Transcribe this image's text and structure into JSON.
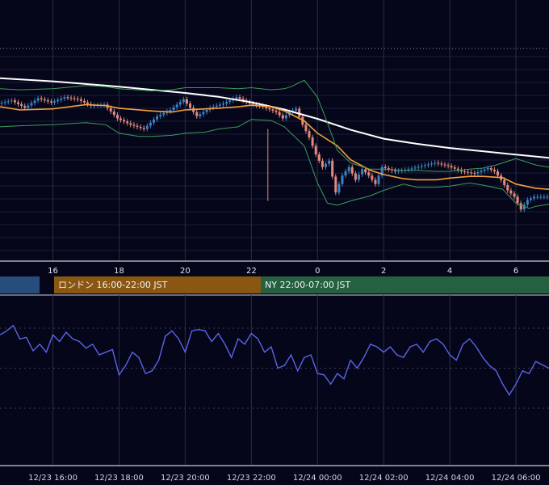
{
  "chart_data": [
    {
      "type": "candlestick",
      "title": "",
      "x_ticks": [
        "16",
        "18",
        "20",
        "22",
        "0",
        "2",
        "4",
        "6"
      ],
      "x_tick_hours": [
        16,
        18,
        20,
        22,
        24,
        26,
        28,
        30
      ],
      "x_range_hours": [
        14.4,
        31.0
      ],
      "y_range": [
        0,
        100
      ],
      "grid": true,
      "overlays": [
        {
          "name": "",
          "kind": "moving-average-long",
          "color": "#ffffff",
          "hours": [
            14.4,
            16,
            18,
            20,
            21,
            22,
            23,
            24,
            25,
            26,
            27,
            28,
            29,
            30,
            31
          ],
          "values": [
            86.0,
            84.5,
            82.0,
            79.0,
            77.2,
            74.6,
            71.2,
            66.8,
            61.6,
            57.4,
            55.0,
            53.0,
            51.5,
            49.9,
            48.4
          ]
        },
        {
          "name": "",
          "kind": "moving-average-short",
          "color": "#f5a03a",
          "hours": [
            14.4,
            15,
            16,
            17,
            17.6,
            18,
            19,
            19.6,
            20,
            21,
            21.6,
            22,
            22.6,
            23,
            23.6,
            24,
            24.6,
            25,
            25.6,
            26,
            26.6,
            27,
            27.6,
            28,
            28.6,
            29,
            29.6,
            30,
            30.6,
            31
          ],
          "values": [
            72.5,
            71.0,
            71.5,
            73.5,
            73.0,
            71.8,
            70.5,
            70.0,
            71.0,
            71.8,
            72.5,
            73.2,
            72.5,
            70.5,
            65.8,
            60.0,
            54.0,
            47.5,
            42.5,
            40.5,
            38.5,
            38.0,
            38.0,
            38.8,
            39.6,
            39.6,
            39.0,
            36.0,
            34.0,
            33.5
          ]
        },
        {
          "name": "",
          "kind": "bollinger-upper",
          "color": "#3c9c5a",
          "hours": [
            14.4,
            15,
            16,
            17,
            17.6,
            18,
            19,
            19.6,
            20,
            21,
            21.6,
            22,
            22.6,
            23,
            23.2,
            23.6,
            24,
            24.3,
            24.6,
            25,
            25.6,
            26,
            26.6,
            27,
            27.6,
            28,
            28.6,
            29,
            29.4,
            30,
            30.6,
            31
          ],
          "values": [
            81.0,
            80.5,
            81.0,
            82.5,
            82.0,
            81.0,
            80.0,
            80.5,
            81.5,
            81.5,
            81.0,
            81.5,
            80.5,
            81.0,
            82.0,
            85.0,
            77.0,
            65.0,
            52.0,
            46.0,
            43.0,
            43.0,
            42.5,
            42.5,
            42.0,
            42.0,
            43.0,
            43.5,
            45.0,
            48.0,
            45.0,
            44.0
          ]
        },
        {
          "name": "",
          "kind": "bollinger-lower",
          "color": "#3c9c5a",
          "hours": [
            14.4,
            15,
            16,
            17,
            17.6,
            18,
            18.6,
            19,
            19.6,
            20,
            20.6,
            21,
            21.6,
            22,
            22.6,
            23,
            23.6,
            24,
            24.3,
            24.6,
            25,
            25.6,
            26,
            26.6,
            27,
            27.6,
            28,
            28.6,
            29,
            29.6,
            30,
            30.4,
            30.6,
            31
          ],
          "values": [
            63.0,
            63.5,
            64.0,
            65.0,
            64.0,
            60.0,
            58.5,
            58.5,
            59.0,
            60.0,
            60.5,
            62.0,
            63.0,
            66.5,
            66.0,
            63.0,
            54.0,
            36.5,
            27.0,
            26.0,
            28.0,
            30.5,
            33.0,
            36.0,
            34.5,
            34.5,
            35.0,
            36.5,
            35.5,
            33.5,
            27.0,
            24.5,
            25.5,
            26.5
          ]
        },
        {
          "name": "",
          "kind": "price-trace",
          "color": "#3b82c4",
          "hours": [
            14.4,
            14.8,
            15.2,
            15.6,
            16.0,
            16.4,
            16.8,
            17.2,
            17.6,
            18.0,
            18.4,
            18.8,
            19.2,
            19.6,
            20.0,
            20.4,
            20.8,
            21.2,
            21.6,
            22.0,
            22.4,
            22.8,
            23.0,
            23.2,
            23.4,
            23.6,
            23.8,
            24.0,
            24.2,
            24.4,
            24.6,
            24.8,
            25.0,
            25.2,
            25.4,
            25.6,
            25.8,
            26.0,
            26.4,
            26.8,
            27.2,
            27.6,
            28.0,
            28.4,
            28.8,
            29.2,
            29.4,
            29.6,
            29.8,
            30.0,
            30.2,
            30.4,
            30.6,
            31.0
          ],
          "values": [
            74.0,
            75.5,
            72.0,
            76.5,
            74.5,
            77.0,
            76.0,
            73.0,
            73.5,
            67.0,
            64.0,
            62.0,
            68.0,
            71.0,
            76.0,
            68.0,
            72.0,
            74.0,
            77.0,
            74.0,
            72.5,
            70.0,
            67.0,
            70.0,
            71.5,
            64.0,
            58.0,
            50.0,
            44.0,
            47.0,
            32.0,
            40.0,
            44.0,
            38.0,
            43.0,
            40.0,
            36.0,
            44.0,
            42.0,
            43.0,
            44.5,
            46.0,
            44.5,
            42.0,
            41.0,
            43.5,
            42.0,
            38.0,
            33.0,
            30.0,
            24.0,
            28.5,
            30.0,
            30.0
          ]
        }
      ],
      "annotations": {
        "dotted_level": 100,
        "spike_low_hour": 22.5,
        "spike_low_value": 28
      }
    },
    {
      "type": "line",
      "title": "",
      "x_ticks": [
        "12/23 16:00",
        "12/23 18:00",
        "12/23 20:00",
        "12/23 22:00",
        "12/24 00:00",
        "12/24 02:00",
        "12/24 04:00",
        "12/24 06:00"
      ],
      "x_tick_hours": [
        16,
        18,
        20,
        22,
        24,
        26,
        28,
        30
      ],
      "x_range_hours": [
        14.4,
        31.0
      ],
      "y_range": [
        0,
        100
      ],
      "grid": true,
      "series": [
        {
          "name": "",
          "color": "#5b64e6",
          "hours": [
            14.4,
            14.6,
            14.8,
            15.0,
            15.2,
            15.4,
            15.6,
            15.8,
            16.0,
            16.2,
            16.4,
            16.6,
            16.8,
            17.0,
            17.2,
            17.4,
            17.6,
            17.8,
            18.0,
            18.2,
            18.4,
            18.6,
            18.8,
            19.0,
            19.2,
            19.4,
            19.6,
            19.8,
            20.0,
            20.2,
            20.4,
            20.6,
            20.8,
            21.0,
            21.2,
            21.4,
            21.6,
            21.8,
            22.0,
            22.2,
            22.4,
            22.6,
            22.8,
            23.0,
            23.2,
            23.4,
            23.6,
            23.8,
            24.0,
            24.2,
            24.4,
            24.6,
            24.8,
            25.0,
            25.2,
            25.4,
            25.6,
            25.8,
            26.0,
            26.2,
            26.4,
            26.6,
            26.8,
            27.0,
            27.2,
            27.4,
            27.6,
            27.8,
            28.0,
            28.2,
            28.4,
            28.6,
            28.8,
            29.0,
            29.2,
            29.4,
            29.6,
            29.8,
            30.0,
            30.2,
            30.4,
            30.6,
            31.0
          ],
          "values": [
            75.0,
            78.0,
            82.0,
            72.0,
            73.0,
            63.0,
            68.0,
            62.0,
            75.0,
            70.0,
            77.0,
            72.0,
            70.0,
            65.0,
            68.0,
            60.0,
            62.0,
            64.0,
            45.0,
            52.0,
            62.0,
            58.0,
            46.0,
            48.0,
            56.0,
            74.0,
            78.0,
            72.0,
            62.0,
            78.0,
            79.0,
            78.0,
            70.0,
            76.0,
            68.0,
            58.0,
            72.0,
            68.0,
            76.0,
            72.0,
            62.0,
            66.0,
            50.0,
            52.0,
            60.0,
            48.0,
            58.0,
            60.0,
            46.0,
            45.0,
            38.0,
            46.0,
            42.0,
            56.0,
            50.0,
            58.0,
            68.0,
            66.0,
            62.0,
            66.0,
            60.0,
            58.0,
            66.0,
            68.0,
            62.0,
            70.0,
            72.0,
            68.0,
            60.0,
            56.0,
            68.0,
            72.0,
            66.0,
            58.0,
            52.0,
            48.0,
            38.0,
            30.0,
            38.0,
            48.0,
            46.0,
            55.0,
            50.0
          ]
        }
      ],
      "annotations": {
        "dashed_levels": [
          80,
          20
        ]
      }
    }
  ],
  "sessions": [
    {
      "id": "tokyo",
      "label": ""
    },
    {
      "id": "london",
      "label": "ロンドン 16:00-22:00 JST"
    },
    {
      "id": "ny",
      "label": "NY 22:00-07:00 JST"
    }
  ],
  "colors": {
    "background": "#05061a",
    "grid": "#1c1f3a",
    "up_candle": "#3b82c4",
    "down_candle": "#e48a7a",
    "panel_divider": "#ffffff"
  }
}
